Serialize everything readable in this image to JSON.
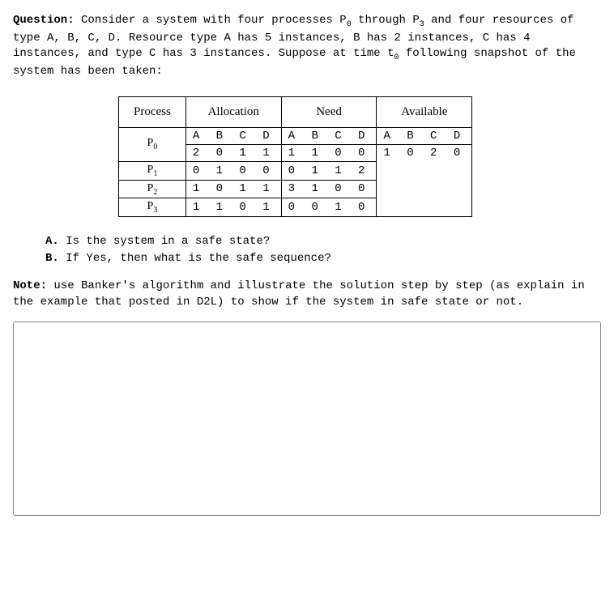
{
  "question": {
    "label": "Question:",
    "body_line1": " Consider a system with four processes P",
    "body_line1_sub": "0",
    "body_line1_cont": " through P",
    "body_line1_sub2": "3",
    "body_line1_end": " and four resources",
    "body_line2": "of type A, B, C, D. Resource type A has 5 instances, B has 2 instances, C has 4 instances, and type C has 3 instances. Suppose at time t",
    "body_line2_sub": "0",
    "body_line2_end": " following snapshot of the system has been taken:"
  },
  "table": {
    "headers": {
      "process": "Process",
      "allocation": "Allocation",
      "need": "Need",
      "available": "Available"
    },
    "col_labels": {
      "abcd1": "A B C D",
      "abcd2": "A B C D",
      "abcd3": "A B C D"
    },
    "rows": [
      {
        "proc": "P",
        "sub": "0",
        "alloc": "2 0 1 1",
        "need": "1 1 0 0",
        "avail": "1 0 2 0"
      },
      {
        "proc": "P",
        "sub": "1",
        "alloc": "0 1 0 0",
        "need": "0 1 1 2",
        "avail": ""
      },
      {
        "proc": "P",
        "sub": "2",
        "alloc": "1 0 1 1",
        "need": "3 1 0 0",
        "avail": ""
      },
      {
        "proc": "P",
        "sub": "3",
        "alloc": "1 1 0 1",
        "need": "0 0 1 0",
        "avail": ""
      }
    ]
  },
  "sub_questions": {
    "a_label": "A.",
    "a_text": " Is the system in a safe state?",
    "b_label": "B.",
    "b_text": " If Yes, then what is the safe sequence?"
  },
  "note": {
    "label": "Note:",
    "text": " use Banker's algorithm and illustrate the solution step by step (as explain in the example that posted in D2L) to show if the system in safe state or not."
  }
}
